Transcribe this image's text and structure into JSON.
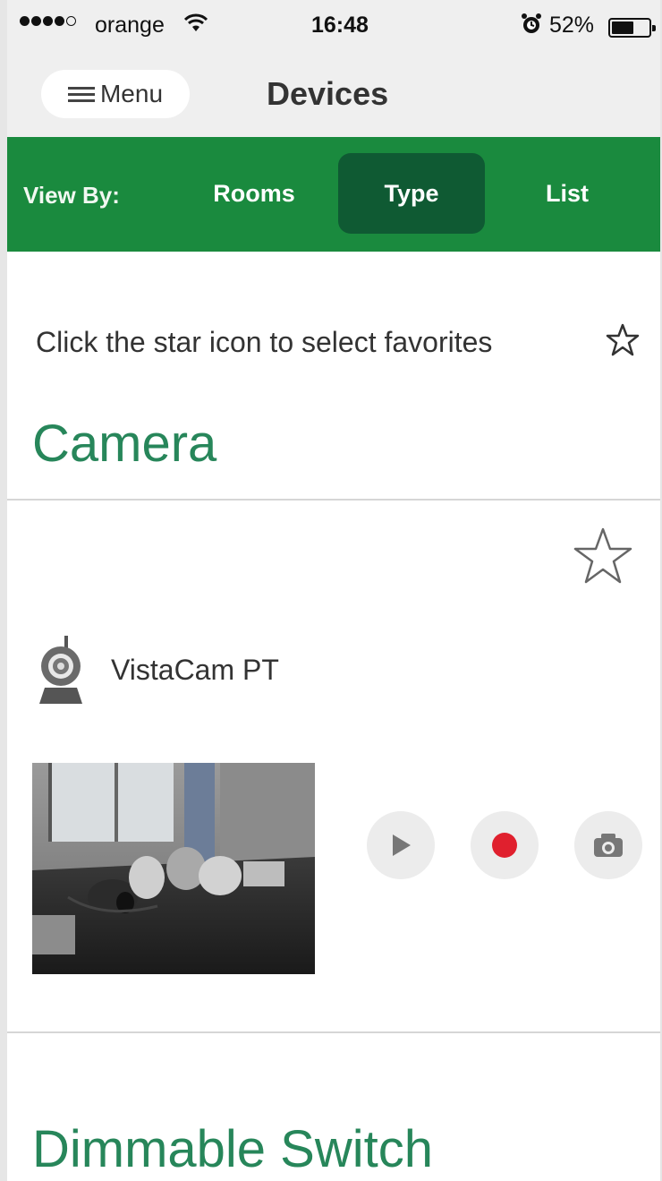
{
  "status_bar": {
    "carrier": "orange",
    "time": "16:48",
    "battery_percent": "52%",
    "battery_level": 0.52,
    "signal_bars_filled": 4,
    "signal_bars_total": 5
  },
  "nav": {
    "menu_label": "Menu",
    "title": "Devices"
  },
  "view_by": {
    "label": "View By:",
    "options": [
      "Rooms",
      "Type",
      "List"
    ],
    "selected": "Type"
  },
  "hint": {
    "text": "Click the star icon to select favorites"
  },
  "sections": [
    {
      "title": "Camera",
      "devices": [
        {
          "name": "VistaCam PT",
          "icon": "camera-device-icon",
          "controls": [
            "play-icon",
            "record-icon",
            "snapshot-icon"
          ]
        }
      ]
    },
    {
      "title": "Dimmable Switch"
    }
  ],
  "colors": {
    "brand_green": "#1a8a3e",
    "selected_green": "#0f5a33",
    "section_title_green": "#27865a",
    "record_red": "#e0202e"
  }
}
